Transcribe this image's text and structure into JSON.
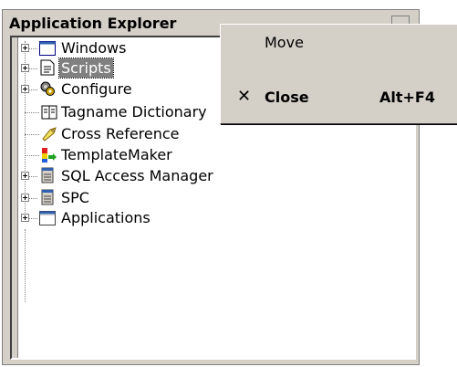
{
  "window": {
    "title": "Application Explorer"
  },
  "tree": {
    "items": [
      {
        "label": "Windows",
        "icon": "window-icon",
        "expandable": true,
        "selected": false
      },
      {
        "label": "Scripts",
        "icon": "script-document-icon",
        "expandable": true,
        "selected": true
      },
      {
        "label": "Configure",
        "icon": "configure-gears-icon",
        "expandable": true,
        "selected": false
      },
      {
        "label": "Tagname Dictionary",
        "icon": "dictionary-book-icon",
        "expandable": false,
        "selected": false
      },
      {
        "label": "Cross Reference",
        "icon": "cross-reference-tag-icon",
        "expandable": false,
        "selected": false
      },
      {
        "label": "TemplateMaker",
        "icon": "template-maker-icon",
        "expandable": false,
        "selected": false
      },
      {
        "label": "SQL Access Manager",
        "icon": "sql-document-icon",
        "expandable": true,
        "selected": false
      },
      {
        "label": "SPC",
        "icon": "spc-document-icon",
        "expandable": true,
        "selected": false
      },
      {
        "label": "Applications",
        "icon": "applications-window-icon",
        "expandable": true,
        "selected": false
      }
    ]
  },
  "context_menu": {
    "move_label": "Move",
    "close_label": "Close",
    "close_glyph": "✕",
    "close_shortcut": "Alt+F4"
  },
  "colors": {
    "selection": "#808080",
    "panel": "#d4d0c8"
  }
}
